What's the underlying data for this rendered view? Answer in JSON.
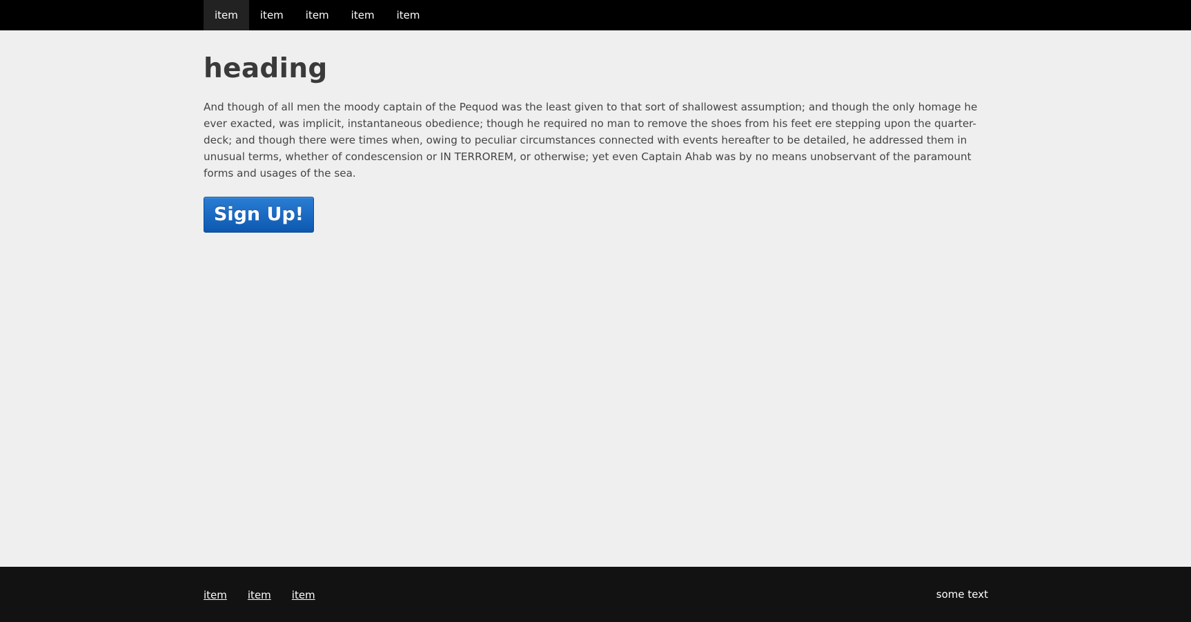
{
  "nav": {
    "items": [
      {
        "label": "item"
      },
      {
        "label": "item"
      },
      {
        "label": "item"
      },
      {
        "label": "item"
      },
      {
        "label": "item"
      }
    ]
  },
  "main": {
    "heading": "heading",
    "paragraph": "And though of all men the moody captain of the Pequod was the least given to that sort of shallowest assumption; and though the only homage he ever exacted, was implicit, instantaneous obedience; though he required no man to remove the shoes from his feet ere stepping upon the quarter-deck; and though there were times when, owing to peculiar circumstances connected with events hereafter to be detailed, he addressed them in unusual terms, whether of condescension or IN TERROREM, or otherwise; yet even Captain Ahab was by no means unobservant of the paramount forms and usages of the sea.",
    "signup_label": "Sign Up!"
  },
  "footer": {
    "links": [
      {
        "label": "item"
      },
      {
        "label": "item"
      },
      {
        "label": "item"
      }
    ],
    "text": "some text"
  }
}
